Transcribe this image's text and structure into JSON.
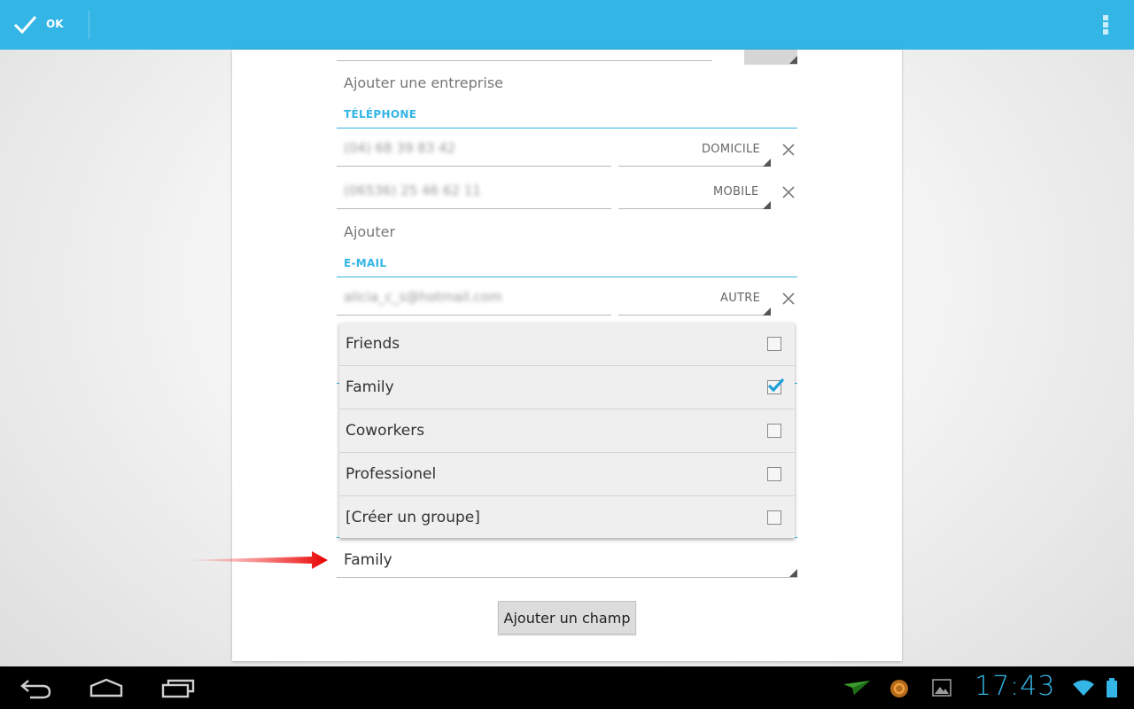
{
  "actionbar": {
    "ok_label": "OK",
    "ok_icon": "check-icon",
    "menu_icon": "overflow-menu-icon",
    "color": "#33b5e5"
  },
  "form": {
    "company_placeholder": "Ajouter une entreprise",
    "phone_section": "TÉLÉPHONE",
    "phones": [
      {
        "number": "(04) 68 39 83 42",
        "type": "DOMICILE"
      },
      {
        "number": "(06536) 25 46 62 11",
        "type": "MOBILE"
      }
    ],
    "phone_add": "Ajouter",
    "email_section": "E-MAIL",
    "emails": [
      {
        "address": "alicia_c_s@hotmail.com",
        "type": "AUTRE"
      }
    ],
    "group_value": "Family",
    "add_field_button": "Ajouter un champ"
  },
  "group_dropdown": {
    "items": [
      {
        "label": "Friends",
        "checked": false
      },
      {
        "label": "Family",
        "checked": true
      },
      {
        "label": "Coworkers",
        "checked": false
      },
      {
        "label": "Professionel",
        "checked": false
      },
      {
        "label": "[Créer un groupe]",
        "checked": false
      }
    ]
  },
  "system_bar": {
    "time": "17:43",
    "accent": "#33b5e5"
  }
}
